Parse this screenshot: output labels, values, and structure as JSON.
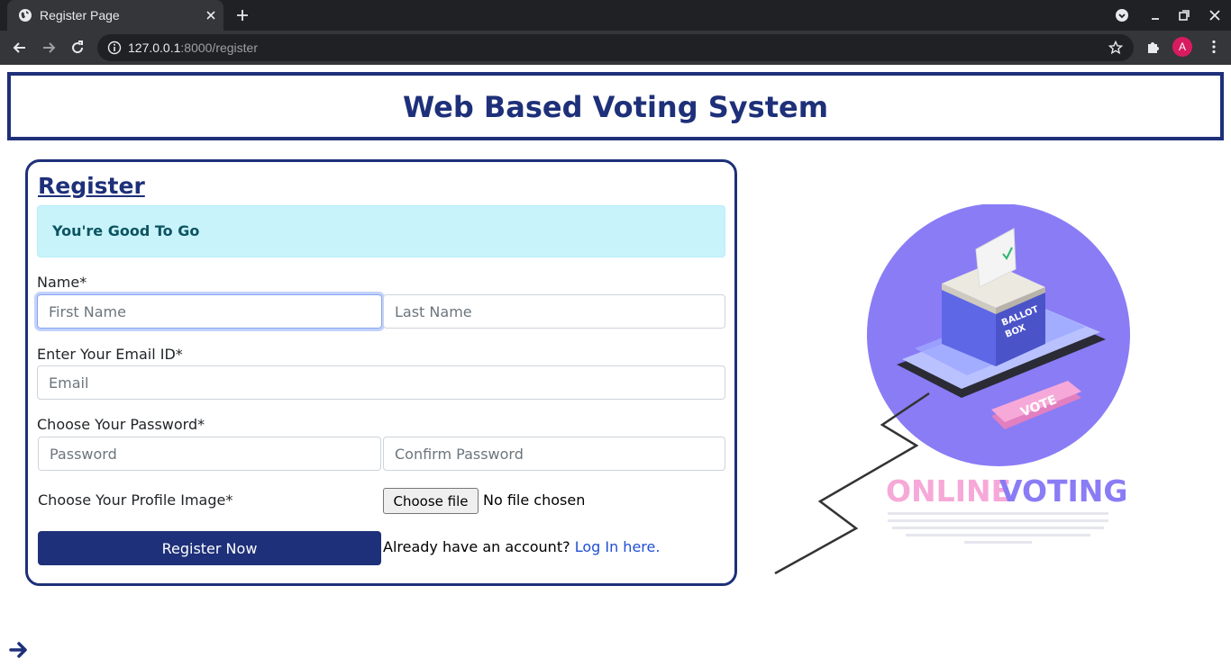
{
  "browser": {
    "tab_title": "Register Page",
    "url_host": "127.0.0.1",
    "url_path": ":8000/register",
    "avatar_letter": "A"
  },
  "header": {
    "title": "Web Based Voting System"
  },
  "form": {
    "title": "Register",
    "alert": "You're Good To Go",
    "name_label": "Name*",
    "first_name_placeholder": "First Name",
    "last_name_placeholder": "Last Name",
    "email_label": "Enter Your Email ID*",
    "email_placeholder": "Email",
    "password_label": "Choose Your Password*",
    "password_placeholder": "Password",
    "confirm_placeholder": "Confirm Password",
    "image_label": "Choose Your Profile Image*",
    "file_button": "Choose file",
    "file_status": "No file chosen",
    "submit_label": "Register Now",
    "login_prompt": "Already have an account?",
    "login_link": "Log In here."
  },
  "illustration": {
    "word_online": "ONLINE",
    "word_voting": "VOTING",
    "box_text_1": "BALLOT",
    "box_text_2": "BOX",
    "button_text": "VOTE"
  },
  "colors": {
    "brand": "#1e3079",
    "alert_bg": "#c9f3fb",
    "link": "#1f4fd6",
    "purple": "#8a7cf5",
    "pink": "#f6a9d8"
  },
  "icons": [
    "globe-icon",
    "close-icon",
    "plus-icon",
    "back-arrow-icon",
    "forward-arrow-icon",
    "reload-icon",
    "info-icon",
    "star-icon",
    "puzzle-icon",
    "menu-icon",
    "arrow-right-icon"
  ]
}
